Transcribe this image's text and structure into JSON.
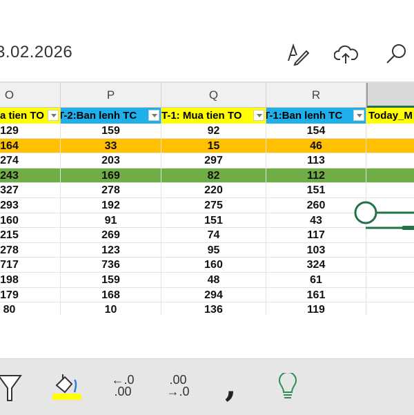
{
  "header": {
    "title": "3.02.2026",
    "icons": [
      "edit-text-icon",
      "cloud-upload-icon",
      "search-icon"
    ]
  },
  "columns": [
    {
      "letter": "O",
      "field": "a tien TO",
      "fill": "#ffff00"
    },
    {
      "letter": "P",
      "field": "T-2:Ban lenh TC",
      "fill": "#1fb0ea"
    },
    {
      "letter": "Q",
      "field": "T-1: Mua tien TO",
      "fill": "#ffff00"
    },
    {
      "letter": "R",
      "field": "T-1:Ban lenh TC",
      "fill": "#1fb0ea"
    },
    {
      "letter": "",
      "field": "Today_M",
      "fill": "#ffff00"
    }
  ],
  "rows": [
    {
      "cells": [
        "129",
        "159",
        "92",
        "154"
      ],
      "fill": ""
    },
    {
      "cells": [
        "164",
        "33",
        "15",
        "46"
      ],
      "fill": "#ffc000"
    },
    {
      "cells": [
        "274",
        "203",
        "297",
        "113"
      ],
      "fill": ""
    },
    {
      "cells": [
        "243",
        "169",
        "82",
        "112"
      ],
      "fill": "#70ad47"
    },
    {
      "cells": [
        "327",
        "278",
        "220",
        "151"
      ],
      "fill": ""
    },
    {
      "cells": [
        "293",
        "192",
        "275",
        "260"
      ],
      "fill": ""
    },
    {
      "cells": [
        "160",
        "91",
        "151",
        "43"
      ],
      "fill": ""
    },
    {
      "cells": [
        "215",
        "269",
        "74",
        "117"
      ],
      "fill": ""
    },
    {
      "cells": [
        "278",
        "123",
        "95",
        "103"
      ],
      "fill": ""
    },
    {
      "cells": [
        "717",
        "736",
        "160",
        "324"
      ],
      "fill": ""
    },
    {
      "cells": [
        "198",
        "159",
        "48",
        "61"
      ],
      "fill": ""
    },
    {
      "cells": [
        "179",
        "168",
        "294",
        "161"
      ],
      "fill": ""
    },
    {
      "cells": [
        "80",
        "10",
        "136",
        "119"
      ],
      "fill": ""
    }
  ],
  "toolbar": {
    "icons": [
      "filter-icon",
      "fill-color-icon",
      "decrease-decimal-icon",
      "increase-decimal-icon",
      "comma-style-icon",
      "lightbulb-icon"
    ],
    "fill_color": "#ffff00",
    "decrease_decimal": {
      "top": "←.0",
      "bottom": ".00"
    },
    "increase_decimal": {
      "top": ".00",
      "bottom": "→.0"
    },
    "comma": ","
  }
}
